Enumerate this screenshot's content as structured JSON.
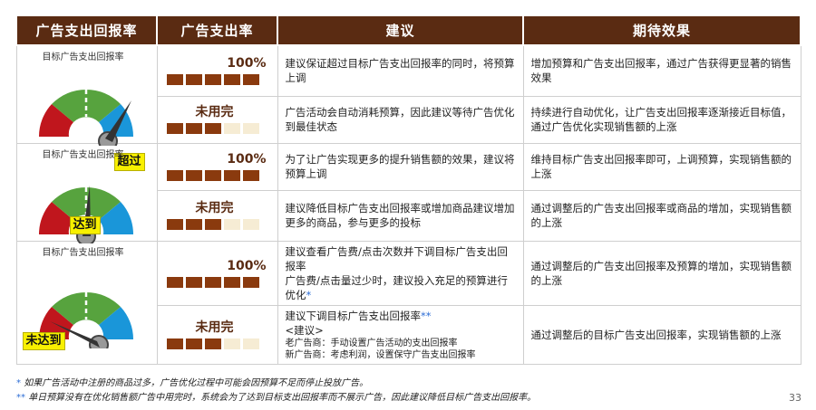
{
  "header": {
    "col1": "广告支出回报率",
    "col2": "广告支出率",
    "col3": "建议",
    "col4": "期待效果"
  },
  "gauge_title": "目标广告支出回报率",
  "rate_full": "100%",
  "rate_unused": "未用完",
  "groups": [
    {
      "tag": "超过",
      "rows": [
        {
          "advice": "建议保证超过目标广告支出回报率的同时，将预算上调",
          "effect": "增加预算和广告支出回报率，通过广告获得更显著的销售效果"
        },
        {
          "advice": "广告活动会自动消耗预算，因此建议等待广告优化到最佳状态",
          "effect": "持续进行自动优化，让广告支出回报率逐渐接近目标值，通过广告优化实现销售额的上涨"
        }
      ]
    },
    {
      "tag": "达到",
      "rows": [
        {
          "advice": "为了让广告实现更多的提升销售额的效果，建议将预算上调",
          "effect": "维持目标广告支出回报率即可，上调预算，实现销售额的上涨"
        },
        {
          "advice": "建议降低目标广告支出回报率或增加商品建议增加更多的商品，参与更多的投标",
          "effect": "通过调整后的广告支出回报率或商品的增加，实现销售额的上涨"
        }
      ]
    },
    {
      "tag": "未达到",
      "rows": [
        {
          "advice_a": "建议查看广告费/点击次数并下调目标广告支出回报率",
          "advice_b": "广告费/点击量过少时，建议投入充足的预算进行优化",
          "advice_b_star": "*",
          "effect": "通过调整后的广告支出回报率及预算的增加，实现销售额的上涨"
        },
        {
          "advice_a": "建议下调目标广告支出回报率",
          "advice_a_star": "**",
          "advice_b": "<建议>",
          "advice_c": "老广告商：手动设置广告活动的支出回报率",
          "advice_d": "新广告商：考虑利润，设置保守广告支出回报率",
          "effect": "通过调整后的目标广告支出回报率，实现销售额的上涨"
        }
      ]
    }
  ],
  "footnotes": {
    "n1_star": "*",
    "n1": "如果广告活动中注册的商品过多，广告优化过程中可能会因预算不足而停止投放广告。",
    "n2_star": "**",
    "n2": "单日预算没有在优化销售额广告中用完时，系统会为了达到目标支出回报率而不展示广告，因此建议降低目标广告支出回报率。"
  },
  "page_number": "33",
  "colors": {
    "header_bg": "#5a2b12",
    "bar_full": "#8a3a0e",
    "bar_empty": "#f6ecd4",
    "tag_bg": "#f8f000"
  }
}
